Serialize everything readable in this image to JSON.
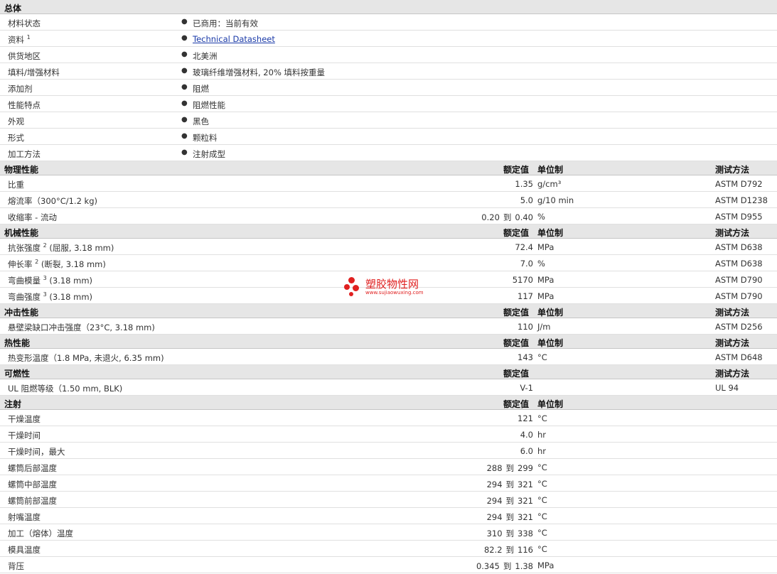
{
  "general": {
    "title": "总体",
    "items": [
      {
        "label": "材料状态",
        "value": "已商用：当前有效"
      },
      {
        "label": "资料",
        "sup": "1",
        "value": "Technical Datasheet",
        "link": true
      },
      {
        "label": "供货地区",
        "value": "北美洲"
      },
      {
        "label": "填料/增强材料",
        "value": "玻璃纤维增强材料, 20% 填料按重量"
      },
      {
        "label": "添加剂",
        "value": "阻燃"
      },
      {
        "label": "性能特点",
        "value": "阻燃性能"
      },
      {
        "label": "外观",
        "value": "黑色"
      },
      {
        "label": "形式",
        "value": "颗粒料"
      },
      {
        "label": "加工方法",
        "value": "注射成型"
      }
    ]
  },
  "headers": {
    "nominal": "额定值",
    "unit": "单位制",
    "method": "测试方法",
    "to": "到"
  },
  "sections": [
    {
      "title": "物理性能",
      "show_unit": true,
      "show_method": true,
      "rows": [
        {
          "label": "比重",
          "value": "1.35",
          "unit": "g/cm³",
          "method": "ASTM D792"
        },
        {
          "label": "熔流率（300°C/1.2 kg)",
          "value": "5.0",
          "unit": "g/10 min",
          "method": "ASTM D1238"
        },
        {
          "label": "收缩率 - 流动",
          "from": "0.20",
          "to": "0.40",
          "unit": "%",
          "method": "ASTM D955"
        }
      ]
    },
    {
      "title": "机械性能",
      "show_unit": true,
      "show_method": true,
      "rows": [
        {
          "label": "抗张强度",
          "sup": "2",
          "suffix": "(屈服, 3.18 mm)",
          "value": "72.4",
          "unit": "MPa",
          "method": "ASTM D638"
        },
        {
          "label": "伸长率",
          "sup": "2",
          "suffix": "(断裂, 3.18 mm)",
          "value": "7.0",
          "unit": "%",
          "method": "ASTM D638"
        },
        {
          "label": "弯曲模量",
          "sup": "3",
          "suffix": "(3.18 mm)",
          "value": "5170",
          "unit": "MPa",
          "method": "ASTM D790"
        },
        {
          "label": "弯曲强度",
          "sup": "3",
          "suffix": "(3.18 mm)",
          "value": "117",
          "unit": "MPa",
          "method": "ASTM D790"
        }
      ]
    },
    {
      "title": "冲击性能",
      "show_unit": true,
      "show_method": true,
      "rows": [
        {
          "label": "悬壁梁缺口冲击强度（23°C, 3.18 mm)",
          "value": "110",
          "unit": "J/m",
          "method": "ASTM D256"
        }
      ]
    },
    {
      "title": "热性能",
      "show_unit": true,
      "show_method": true,
      "rows": [
        {
          "label": "热变形温度（1.8 MPa, 未退火, 6.35 mm)",
          "value": "143",
          "unit": "°C",
          "method": "ASTM D648"
        }
      ]
    },
    {
      "title": "可燃性",
      "show_unit": false,
      "show_method": true,
      "rows": [
        {
          "label": "UL 阻燃等级（1.50 mm, BLK)",
          "value": "V-1",
          "unit": "",
          "method": "UL 94"
        }
      ]
    },
    {
      "title": "注射",
      "show_unit": true,
      "show_method": false,
      "rows": [
        {
          "label": "干燥温度",
          "value": "121",
          "unit": "°C",
          "method": ""
        },
        {
          "label": "干燥时间",
          "value": "4.0",
          "unit": "hr",
          "method": ""
        },
        {
          "label": "干燥时间，最大",
          "value": "6.0",
          "unit": "hr",
          "method": ""
        },
        {
          "label": "螺筒后部温度",
          "from": "288",
          "to": "299",
          "unit": "°C",
          "method": ""
        },
        {
          "label": "螺筒中部温度",
          "from": "294",
          "to": "321",
          "unit": "°C",
          "method": ""
        },
        {
          "label": "螺筒前部温度",
          "from": "294",
          "to": "321",
          "unit": "°C",
          "method": ""
        },
        {
          "label": "射嘴温度",
          "from": "294",
          "to": "321",
          "unit": "°C",
          "method": ""
        },
        {
          "label": "加工（熔体）温度",
          "from": "310",
          "to": "338",
          "unit": "°C",
          "method": ""
        },
        {
          "label": "模具温度",
          "from": "82.2",
          "to": "116",
          "unit": "°C",
          "method": ""
        },
        {
          "label": "背压",
          "from": "0.345",
          "to": "1.38",
          "unit": "MPa",
          "method": ""
        }
      ]
    }
  ],
  "watermark": {
    "text": "塑胶物性网",
    "url": "www.sujiaowuxing.com",
    "color": "#e02020"
  }
}
